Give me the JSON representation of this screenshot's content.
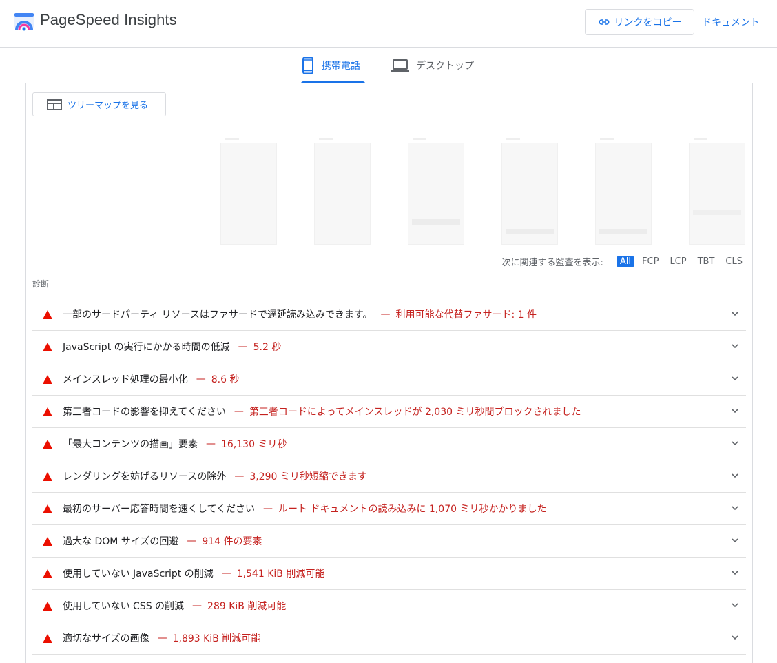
{
  "header": {
    "app_title": "PageSpeed Insights",
    "copy_link_label": "リンクをコピー",
    "docs_label": "ドキュメント"
  },
  "tabs": [
    {
      "label": "携帯電話",
      "icon": "smartphone-icon",
      "active": true
    },
    {
      "label": "デスクトップ",
      "icon": "laptop-icon",
      "active": false
    }
  ],
  "treemap_button": {
    "label": "ツリーマップを見る",
    "icon": "treemap-icon"
  },
  "filter": {
    "label": "次に関連する監査を表示:",
    "chips": [
      {
        "label": "All",
        "active": true
      },
      {
        "label": "FCP",
        "active": false
      },
      {
        "label": "LCP",
        "active": false
      },
      {
        "label": "TBT",
        "active": false
      },
      {
        "label": "CLS",
        "active": false
      }
    ]
  },
  "section_label": "診断",
  "audits": [
    {
      "title": "一部のサードパーティ リソースはファサードで遅延読み込みできます。",
      "sep": "—",
      "detail": "利用可能な代替ファサード: 1 件"
    },
    {
      "title": "JavaScript の実行にかかる時間の低減",
      "sep": "—",
      "detail": "5.2 秒"
    },
    {
      "title": "メインスレッド処理の最小化",
      "sep": "—",
      "detail": "8.6 秒"
    },
    {
      "title": "第三者コードの影響を抑えてください",
      "sep": "—",
      "detail": "第三者コードによってメインスレッドが 2,030 ミリ秒間ブロックされました"
    },
    {
      "title": "「最大コンテンツの描画」要素",
      "sep": "—",
      "detail": "16,130 ミリ秒"
    },
    {
      "title": "レンダリングを妨げるリソースの除外",
      "sep": "—",
      "detail": "3,290 ミリ秒短縮できます"
    },
    {
      "title": "最初のサーバー応答時間を速くしてください",
      "sep": "—",
      "detail": "ルート ドキュメントの読み込みに 1,070 ミリ秒かかりました"
    },
    {
      "title": "過大な DOM サイズの回避",
      "sep": "—",
      "detail": "914 件の要素"
    },
    {
      "title": "使用していない JavaScript の削減",
      "sep": "—",
      "detail": "1,541 KiB 削減可能"
    },
    {
      "title": "使用していない CSS の削減",
      "sep": "—",
      "detail": "289 KiB 削減可能"
    },
    {
      "title": "適切なサイズの画像",
      "sep": "—",
      "detail": "1,893 KiB 削減可能"
    }
  ],
  "colors": {
    "accent": "#1a73e8",
    "fail": "#eb0f00",
    "fail_text": "#c5221f"
  }
}
